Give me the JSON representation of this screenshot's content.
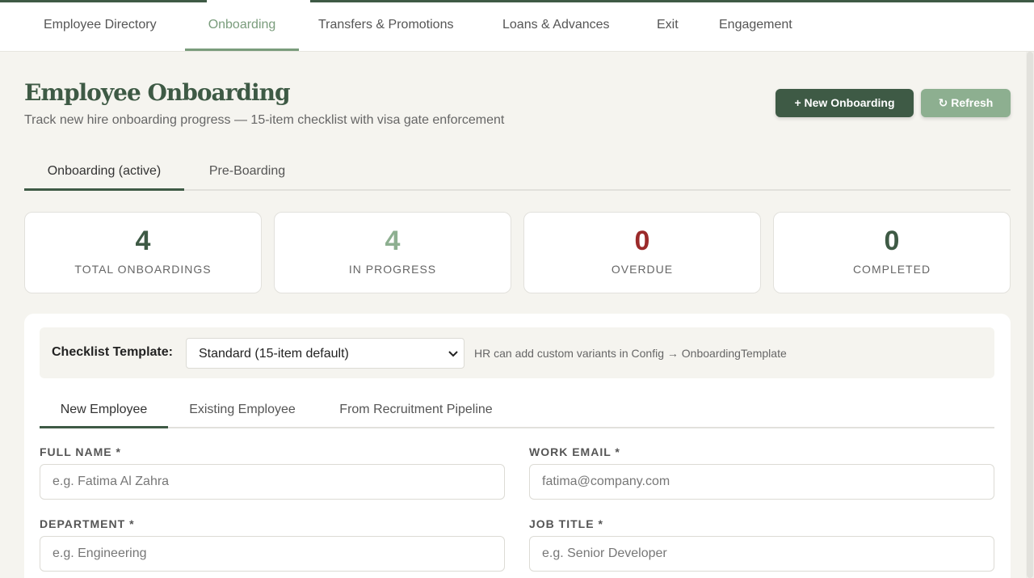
{
  "nav": {
    "tabs": [
      {
        "label": "Employee Directory"
      },
      {
        "label": "Onboarding"
      },
      {
        "label": "Transfers & Promotions"
      },
      {
        "label": "Loans & Advances"
      },
      {
        "label": "Exit"
      },
      {
        "label": "Engagement"
      }
    ],
    "active_color": "#7a9c7c"
  },
  "header": {
    "title": "Employee Onboarding",
    "subtitle": "Track new hire onboarding progress — 15-item checklist with visa gate enforcement",
    "new_button": "+ New Onboarding",
    "refresh_button": "↻ Refresh"
  },
  "subtabs": [
    {
      "label": "Onboarding (active)"
    },
    {
      "label": "Pre-Boarding"
    }
  ],
  "stats": [
    {
      "value": "4",
      "label": "TOTAL ONBOARDINGS",
      "color": "#3e5a45"
    },
    {
      "value": "4",
      "label": "IN PROGRESS",
      "color": "#8daf90"
    },
    {
      "value": "0",
      "label": "OVERDUE",
      "color": "#9b2a2a"
    },
    {
      "value": "0",
      "label": "COMPLETED",
      "color": "#3e5a45"
    }
  ],
  "template": {
    "label": "Checklist Template:",
    "selected": "Standard (15-item default)",
    "hint": "HR can add custom variants in Config → OnboardingTemplate"
  },
  "form_tabs": [
    {
      "label": "New Employee"
    },
    {
      "label": "Existing Employee"
    },
    {
      "label": "From Recruitment Pipeline"
    }
  ],
  "fields": {
    "full_name": {
      "label": "FULL NAME *",
      "placeholder": "e.g. Fatima Al Zahra"
    },
    "work_email": {
      "label": "WORK EMAIL *",
      "placeholder": "fatima@company.com"
    },
    "department": {
      "label": "DEPARTMENT *",
      "placeholder": "e.g. Engineering"
    },
    "job_title": {
      "label": "JOB TITLE *",
      "placeholder": "e.g. Senior Developer"
    }
  },
  "colors": {
    "brand": "#3e5a45",
    "accent": "#8daf90",
    "danger": "#9b2a2a",
    "background": "#f5f4ef"
  }
}
